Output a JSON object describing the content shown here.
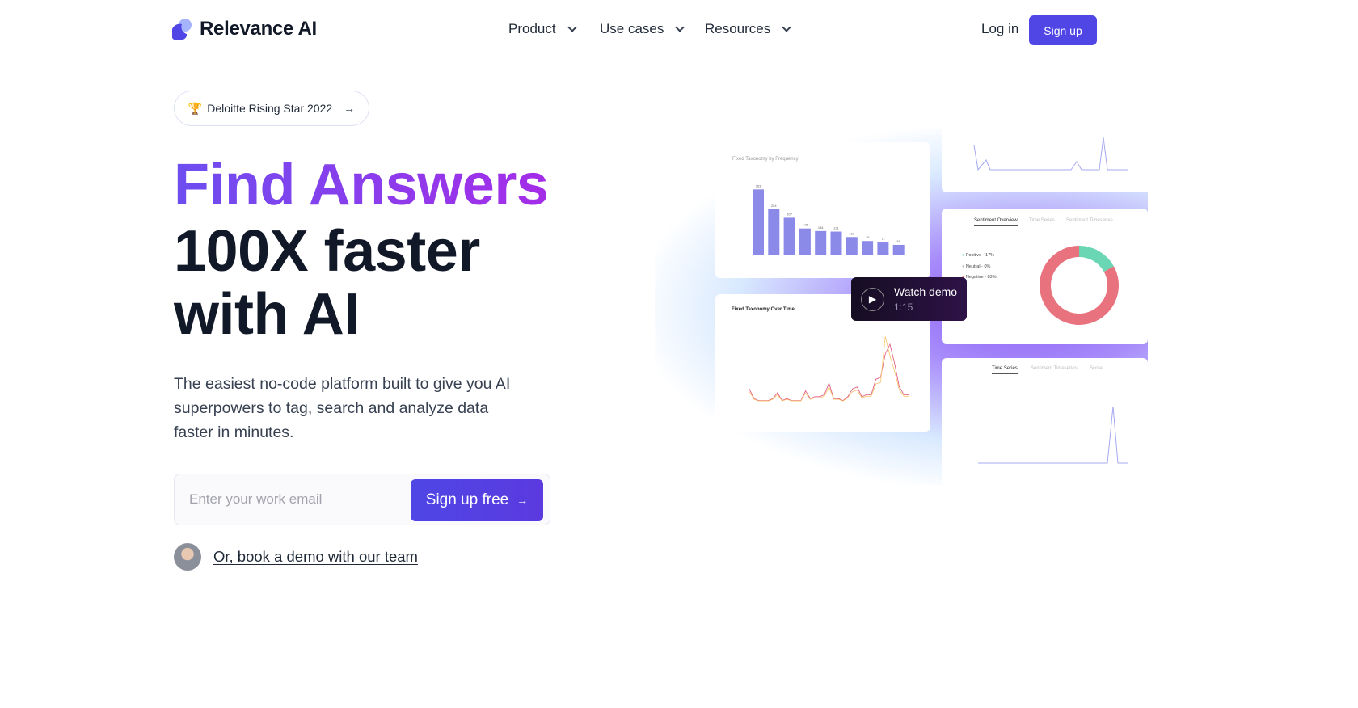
{
  "brand": {
    "name": "Relevance AI",
    "accent": "#4f46e5"
  },
  "nav": {
    "items": [
      {
        "label": "Product"
      },
      {
        "label": "Use cases"
      },
      {
        "label": "Resources"
      }
    ],
    "login": "Log in",
    "signup": "Sign up"
  },
  "badge": {
    "icon": "🏆",
    "label": "Deloitte Rising Star 2022",
    "arrow": "→"
  },
  "hero": {
    "title_accent": "Find Answers",
    "title_line2": "100X faster",
    "title_line3": "with AI",
    "subtitle": "The easiest no-code platform built to give you AI superpowers to tag, search and analyze data faster in minutes."
  },
  "form": {
    "email_placeholder": "Enter your work email",
    "cta": "Sign up free",
    "cta_arrow": "→"
  },
  "demo": {
    "link": "Or, book a demo with our team"
  },
  "video": {
    "label": "Watch demo",
    "duration": "1:15"
  },
  "preview": {
    "freq_title": "Fixed Taxonomy by Frequency",
    "freq_values": [
      363,
      254,
      207,
      148,
      134,
      131,
      101,
      79,
      71,
      58
    ],
    "time_title": "Fixed Taxonomy Over Time",
    "tabs": [
      "Sentiment Overview",
      "Time Series",
      "Sentiment Timeseries"
    ],
    "sentiment": [
      {
        "label": "Positive - 17%",
        "value": 17,
        "color": "#6ad6b4"
      },
      {
        "label": "Neutral - 0%",
        "value": 0,
        "color": "#bbbbbb"
      },
      {
        "label": "Negative - 83%",
        "value": 83,
        "color": "#e8727e"
      }
    ],
    "ts_tabs": [
      "Time Series",
      "Sentiment Timeseries",
      "Score"
    ]
  }
}
